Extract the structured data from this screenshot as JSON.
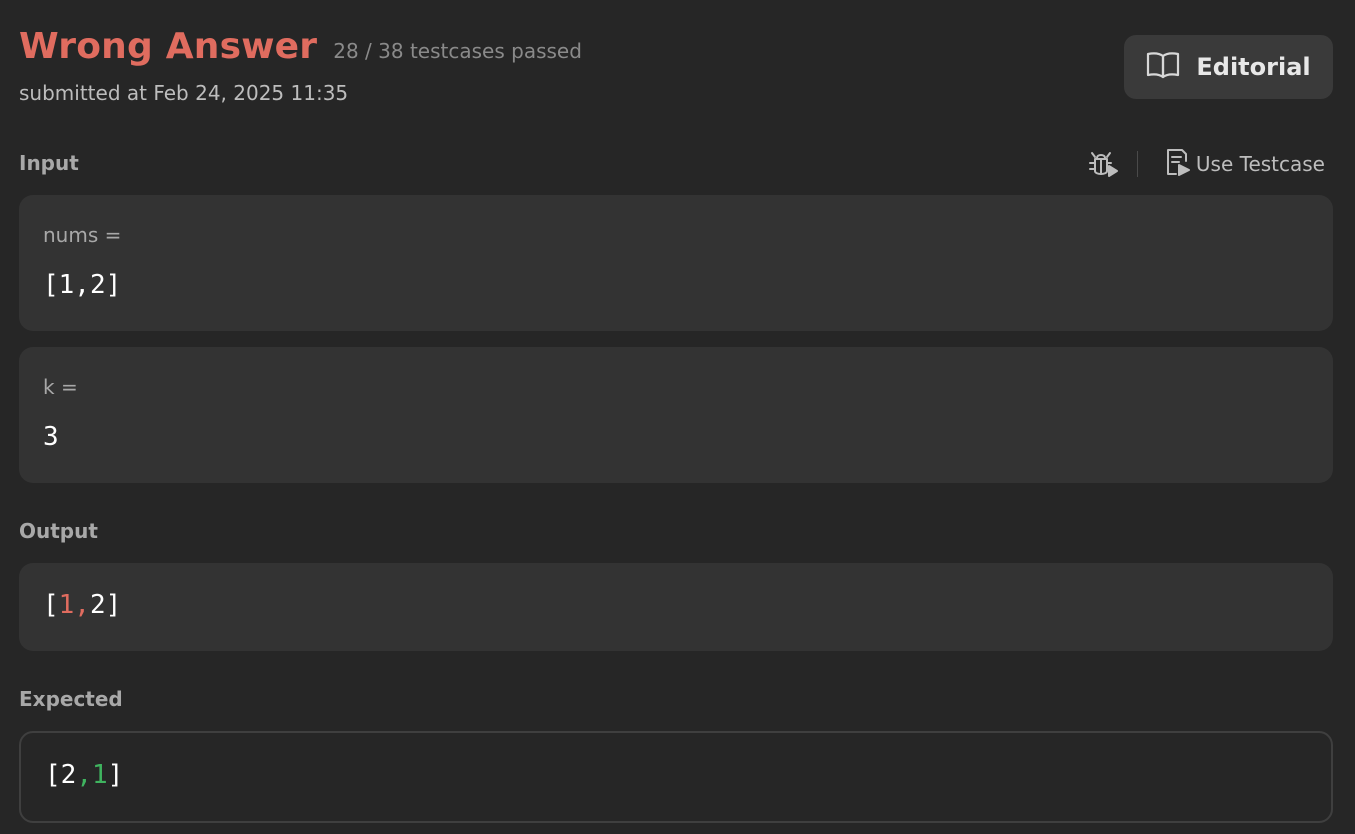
{
  "result": {
    "status": "Wrong Answer",
    "passed_text": "28 / 38 testcases passed",
    "submitted_text": "submitted at Feb 24, 2025 11:35"
  },
  "editorial_button": {
    "label": "Editorial",
    "icon": "book-open-icon"
  },
  "input_section": {
    "label": "Input",
    "toolbar": {
      "debug_icon": "bug-play-icon",
      "use_testcase_icon": "file-play-icon",
      "use_testcase_label": "Use Testcase"
    },
    "params": [
      {
        "name": "nums =",
        "value": "[1,2]"
      },
      {
        "name": "k =",
        "value": "3"
      }
    ]
  },
  "output_section": {
    "label": "Output",
    "tokens": [
      {
        "text": "[",
        "diff": false
      },
      {
        "text": "1,",
        "diff": true
      },
      {
        "text": "2]",
        "diff": false
      }
    ]
  },
  "expected_section": {
    "label": "Expected",
    "tokens": [
      {
        "text": "[2",
        "diff": false
      },
      {
        "text": ",1",
        "diff": true
      },
      {
        "text": "]",
        "diff": false
      }
    ]
  },
  "colors": {
    "wrong": "#e06c5f",
    "diff_output": "#e06c5f",
    "diff_expected": "#3fb45f",
    "background": "#262626",
    "panel": "#333333"
  }
}
